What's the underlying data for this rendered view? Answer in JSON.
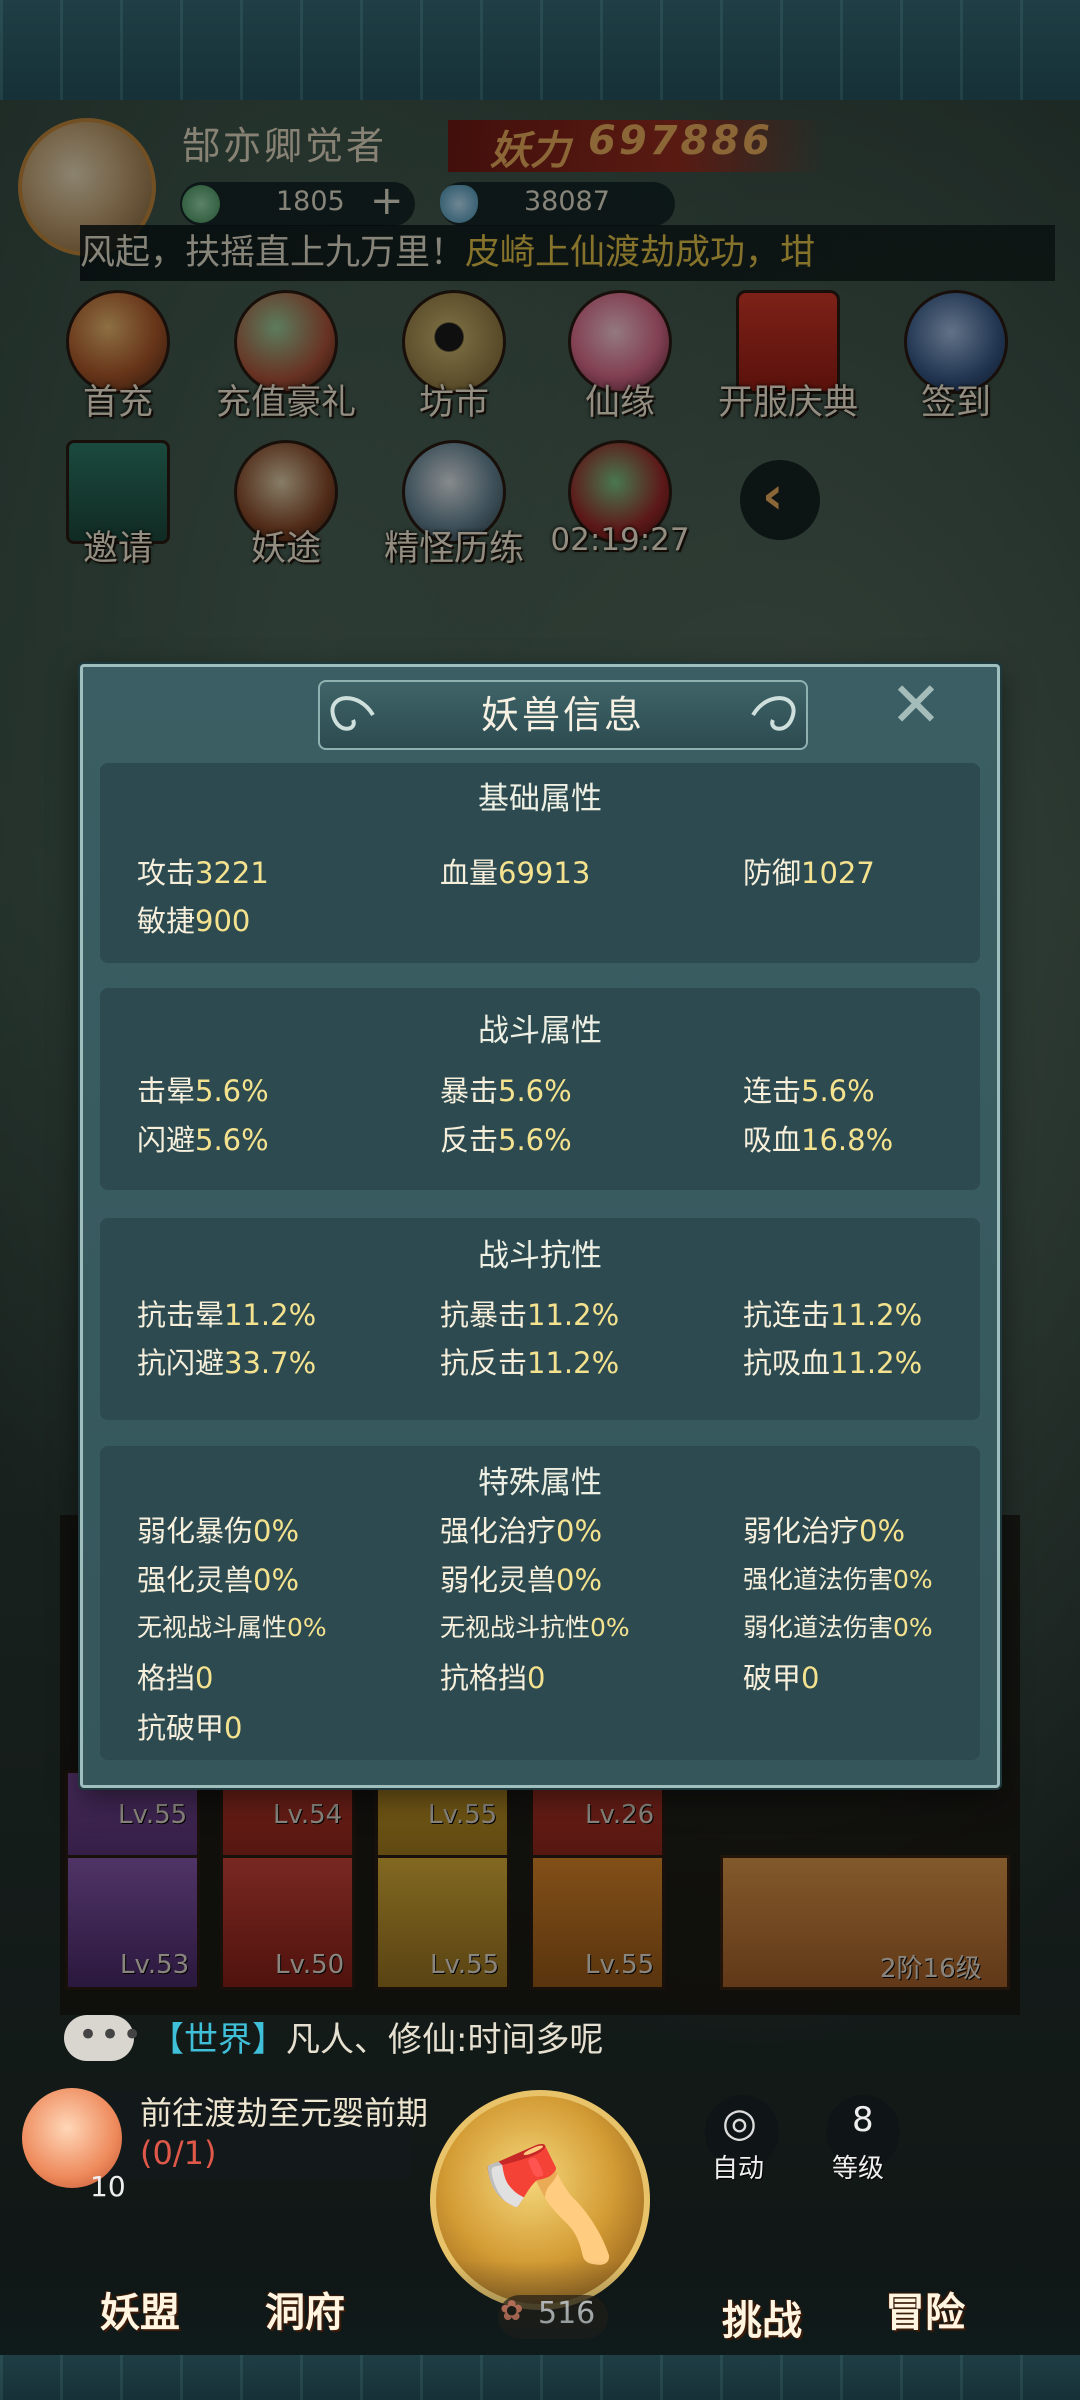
{
  "header": {
    "player_name": "郜亦卿觉者",
    "power_label": "妖力",
    "power_value": "697886",
    "currency_jade": "1805",
    "currency_crystal": "38087",
    "ticker_part1": "风起，扶摇直上九万里！",
    "ticker_part2": "皮崎上仙渡劫成功，坩"
  },
  "features": {
    "row1": [
      "首充",
      "充值豪礼",
      "坊市",
      "仙缘",
      "开服庆典",
      "签到"
    ],
    "row2": [
      "邀请",
      "妖途",
      "精怪历练",
      "02:19:27"
    ]
  },
  "popup": {
    "title": "妖兽信息",
    "sections": [
      {
        "title": "基础属性",
        "items": [
          {
            "k": "攻击",
            "v": "3221"
          },
          {
            "k": "血量",
            "v": "69913"
          },
          {
            "k": "防御",
            "v": "1027"
          },
          {
            "k": "敏捷",
            "v": "900"
          }
        ]
      },
      {
        "title": "战斗属性",
        "items": [
          {
            "k": "击晕",
            "v": "5.6%"
          },
          {
            "k": "暴击",
            "v": "5.6%"
          },
          {
            "k": "连击",
            "v": "5.6%"
          },
          {
            "k": "闪避",
            "v": "5.6%"
          },
          {
            "k": "反击",
            "v": "5.6%"
          },
          {
            "k": "吸血",
            "v": "16.8%"
          }
        ]
      },
      {
        "title": "战斗抗性",
        "items": [
          {
            "k": "抗击晕",
            "v": "11.2%"
          },
          {
            "k": "抗暴击",
            "v": "11.2%"
          },
          {
            "k": "抗连击",
            "v": "11.2%"
          },
          {
            "k": "抗闪避",
            "v": "33.7%"
          },
          {
            "k": "抗反击",
            "v": "11.2%"
          },
          {
            "k": "抗吸血",
            "v": "11.2%"
          }
        ]
      },
      {
        "title": "特殊属性",
        "items": [
          {
            "k": "弱化暴伤",
            "v": "0%"
          },
          {
            "k": "强化治疗",
            "v": "0%"
          },
          {
            "k": "弱化治疗",
            "v": "0%"
          },
          {
            "k": "强化灵兽",
            "v": "0%"
          },
          {
            "k": "弱化灵兽",
            "v": "0%"
          },
          {
            "k": "强化道法伤害",
            "v": "0%"
          },
          {
            "k": "无视战斗属性",
            "v": "0%"
          },
          {
            "k": "无视战斗抗性",
            "v": "0%"
          },
          {
            "k": "弱化道法伤害",
            "v": "0%"
          },
          {
            "k": "格挡",
            "v": "0"
          },
          {
            "k": "抗格挡",
            "v": "0"
          },
          {
            "k": "破甲",
            "v": "0"
          },
          {
            "k": "抗破甲",
            "v": "0"
          }
        ]
      }
    ]
  },
  "cards": {
    "row1_levels": [
      "Lv.55",
      "Lv.54",
      "Lv.55",
      "Lv.26"
    ],
    "row2_levels": [
      "Lv.53",
      "Lv.50",
      "Lv.55",
      "Lv.55"
    ],
    "gourd_level": "2阶16级"
  },
  "chat": {
    "channel": "【世界】",
    "message": "凡人、修仙:时间多呢"
  },
  "bottom": {
    "quest_text": "前往渡劫至元婴前期",
    "quest_progress": "(0/1)",
    "peach_count": "10",
    "auto_label": "自动",
    "level_value": "8",
    "level_label": "等级",
    "energy_value": "516",
    "nav": [
      "妖盟",
      "洞府",
      "挑战",
      "冒险"
    ]
  },
  "colors": {
    "accent_gold": "#f5e28f",
    "ticker_yellow": "#e7c64a",
    "power_orange": "#f0b060",
    "progress_red": "#e0584a"
  }
}
